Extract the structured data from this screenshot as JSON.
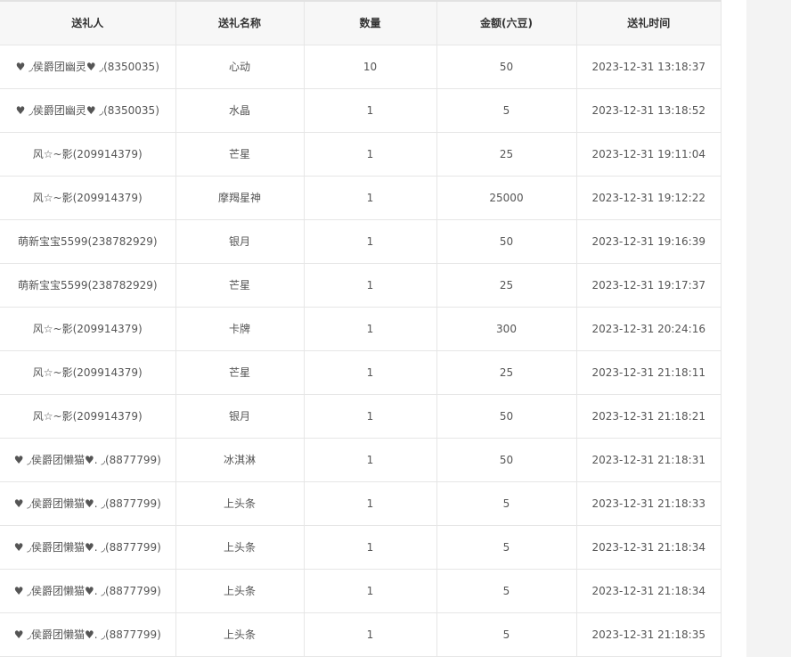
{
  "table": {
    "headers": [
      "送礼人",
      "送礼名称",
      "数量",
      "金额(六豆)",
      "送礼时间"
    ],
    "rows": [
      [
        "♥ ◞侯爵团幽灵♥ ◞(8350035)",
        "心动",
        "10",
        "50",
        "2023-12-31 13:18:37"
      ],
      [
        "♥ ◞侯爵团幽灵♥ ◞(8350035)",
        "水晶",
        "1",
        "5",
        "2023-12-31 13:18:52"
      ],
      [
        "风☆~影(209914379)",
        "芒星",
        "1",
        "25",
        "2023-12-31 19:11:04"
      ],
      [
        "风☆~影(209914379)",
        "摩羯星神",
        "1",
        "25000",
        "2023-12-31 19:12:22"
      ],
      [
        "萌新宝宝5599(238782929)",
        "银月",
        "1",
        "50",
        "2023-12-31 19:16:39"
      ],
      [
        "萌新宝宝5599(238782929)",
        "芒星",
        "1",
        "25",
        "2023-12-31 19:17:37"
      ],
      [
        "风☆~影(209914379)",
        "卡牌",
        "1",
        "300",
        "2023-12-31 20:24:16"
      ],
      [
        "风☆~影(209914379)",
        "芒星",
        "1",
        "25",
        "2023-12-31 21:18:11"
      ],
      [
        "风☆~影(209914379)",
        "银月",
        "1",
        "50",
        "2023-12-31 21:18:21"
      ],
      [
        "♥ ◞侯爵团懒猫♥. ◞(8877799)",
        "冰淇淋",
        "1",
        "50",
        "2023-12-31 21:18:31"
      ],
      [
        "♥ ◞侯爵团懒猫♥. ◞(8877799)",
        "上头条",
        "1",
        "5",
        "2023-12-31 21:18:33"
      ],
      [
        "♥ ◞侯爵团懒猫♥. ◞(8877799)",
        "上头条",
        "1",
        "5",
        "2023-12-31 21:18:34"
      ],
      [
        "♥ ◞侯爵团懒猫♥. ◞(8877799)",
        "上头条",
        "1",
        "5",
        "2023-12-31 21:18:34"
      ],
      [
        "♥ ◞侯爵团懒猫♥. ◞(8877799)",
        "上头条",
        "1",
        "5",
        "2023-12-31 21:18:35"
      ]
    ]
  }
}
